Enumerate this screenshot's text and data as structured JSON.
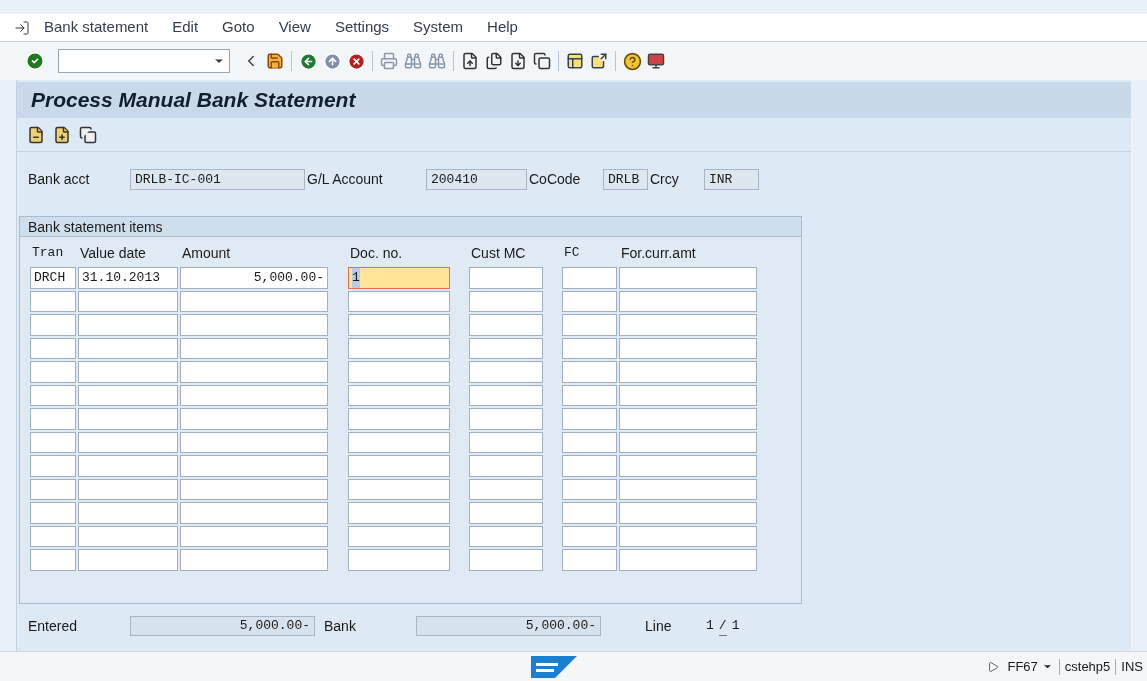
{
  "menu": [
    "Bank statement",
    "Edit",
    "Goto",
    "View",
    "Settings",
    "System",
    "Help"
  ],
  "title": "Process Manual Bank Statement",
  "header_fields": [
    {
      "label": "Bank acct",
      "value": "DRLB-IC-001"
    },
    {
      "label": "G/L Account",
      "value": "200410"
    },
    {
      "label": "CoCode",
      "value": "DRLB"
    },
    {
      "label": "Crcy",
      "value": "INR"
    }
  ],
  "items": {
    "title": "Bank statement items",
    "columns": [
      "Tran",
      "Value date",
      "Amount",
      "Doc. no.",
      "Cust MC",
      "FC",
      "For.curr.amt"
    ],
    "rows": [
      {
        "cells": [
          {
            "value": "DRCH",
            "focused": false
          },
          {
            "value": "31.10.2013",
            "focused": false
          },
          {
            "value": "5,000.00-",
            "focused": false
          },
          {
            "value": "1",
            "focused": true
          }
        ]
      },
      {
        "cells": []
      },
      {
        "cells": []
      },
      {
        "cells": []
      },
      {
        "cells": []
      },
      {
        "cells": []
      },
      {
        "cells": []
      },
      {
        "cells": []
      },
      {
        "cells": []
      },
      {
        "cells": []
      },
      {
        "cells": []
      },
      {
        "cells": []
      },
      {
        "cells": []
      }
    ]
  },
  "totals": {
    "entered_label": "Entered",
    "entered": "5,000.00-",
    "bank_label": "Bank",
    "bank": "5,000.00-",
    "line_label": "Line",
    "line_current": "1",
    "line_sep": "/",
    "line_total": "1"
  },
  "status_bar": {
    "transaction": "FF67",
    "server": "cstehp5",
    "mode": "INS"
  }
}
